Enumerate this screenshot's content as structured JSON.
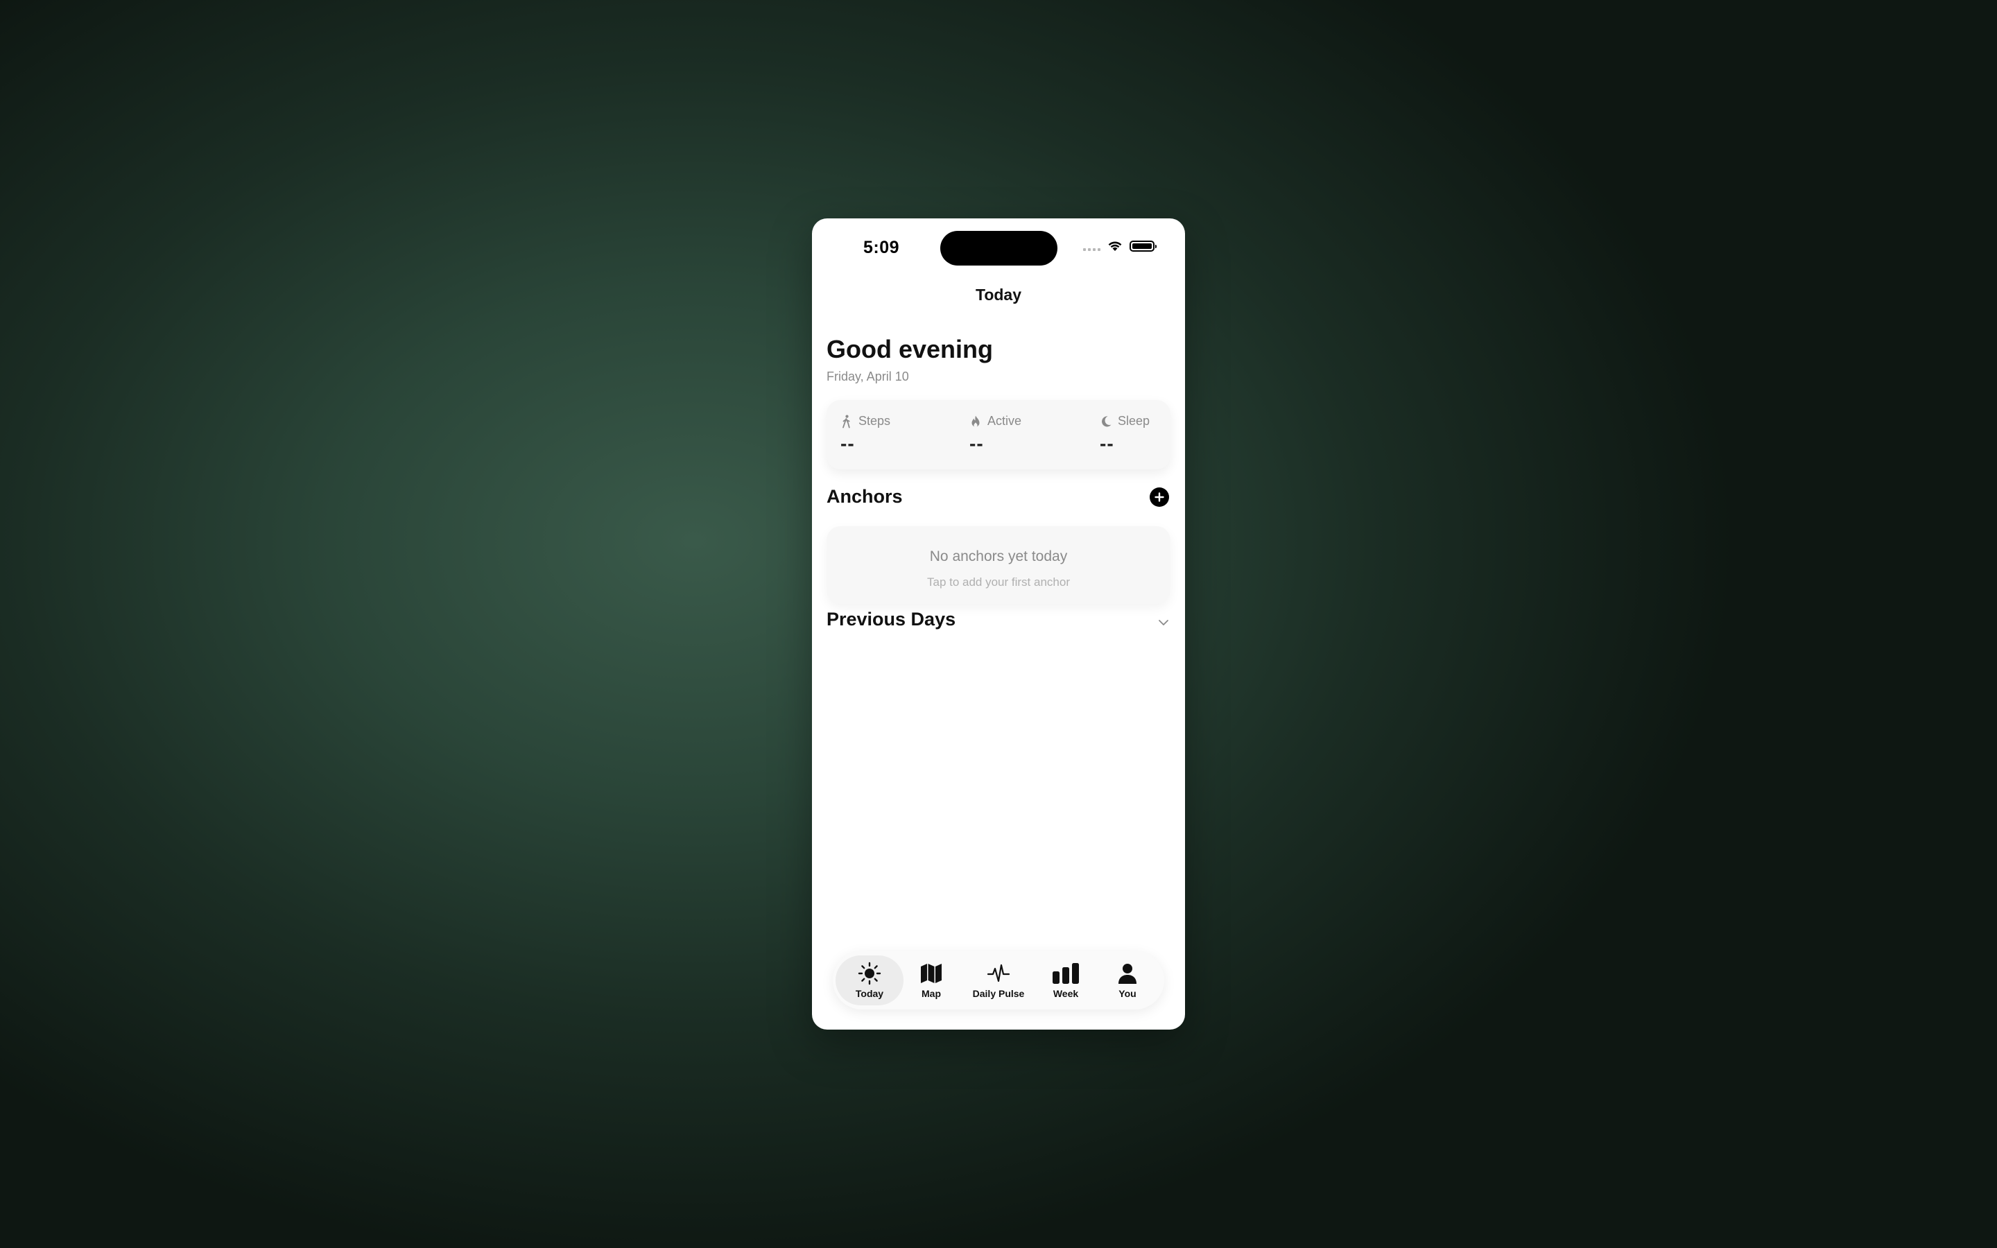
{
  "status_bar": {
    "time": "5:09"
  },
  "nav": {
    "title": "Today"
  },
  "header": {
    "greeting": "Good evening",
    "date": "Friday, April 10"
  },
  "stats": [
    {
      "label": "Steps",
      "value": "--",
      "icon": "walking-icon"
    },
    {
      "label": "Active",
      "value": "--",
      "icon": "flame-icon"
    },
    {
      "label": "Sleep",
      "value": "--",
      "icon": "moon-icon"
    }
  ],
  "anchors": {
    "title": "Anchors",
    "add_icon": "plus-circle-icon",
    "empty_title": "No anchors yet today",
    "empty_subtitle": "Tap to add your first anchor"
  },
  "previous_days": {
    "title": "Previous Days",
    "icon": "chevron-down-icon"
  },
  "tabs": [
    {
      "label": "Today",
      "icon": "sun-icon",
      "active": true
    },
    {
      "label": "Map",
      "icon": "map-icon",
      "active": false
    },
    {
      "label": "Daily Pulse",
      "icon": "pulse-icon",
      "active": false
    },
    {
      "label": "Week",
      "icon": "bar-chart-icon",
      "active": false
    },
    {
      "label": "You",
      "icon": "person-icon",
      "active": false
    }
  ],
  "colors": {
    "background": "#2a4538",
    "card": "#f7f7f7",
    "text_primary": "#111111",
    "text_secondary": "#8a8a8a",
    "accent": "#000000"
  }
}
